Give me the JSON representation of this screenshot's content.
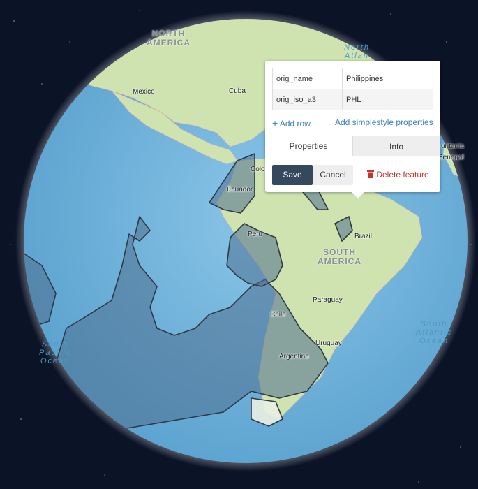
{
  "map": {
    "continent_labels": {
      "north_america": "NORTH\nAMERICA",
      "south_america": "SOUTH\nAMERICA"
    },
    "country_labels": {
      "mexico": "Mexico",
      "cuba": "Cuba",
      "colombia": "Colo",
      "ecuador": "Ecuador",
      "peru": "Peru",
      "brazil": "Brazil",
      "paraguay": "Paraguay",
      "chile": "Chile",
      "uruguay": "Uruguay",
      "argentina": "Argentina",
      "mauritania": "uritania",
      "senegal": "Senegal"
    },
    "ocean_labels": {
      "north_atlantic": "North\nAtlan",
      "south_atlantic": "South\nAtlantic\nOcean",
      "south_pacific": "South\nPacific\nOcean"
    },
    "colors": {
      "ocean": "#6fb2d9",
      "land": "#cfe3b0",
      "selection": "#4f6f8f",
      "space": "#0b1326"
    }
  },
  "popup": {
    "properties": [
      {
        "key": "orig_name",
        "value": "Philippines"
      },
      {
        "key": "orig_iso_a3",
        "value": "PHL"
      }
    ],
    "add_row": "Add row",
    "add_simplestyle": "Add simplestyle properties",
    "tabs": {
      "properties": "Properties",
      "info": "Info"
    },
    "save": "Save",
    "cancel": "Cancel",
    "delete": "Delete feature"
  }
}
